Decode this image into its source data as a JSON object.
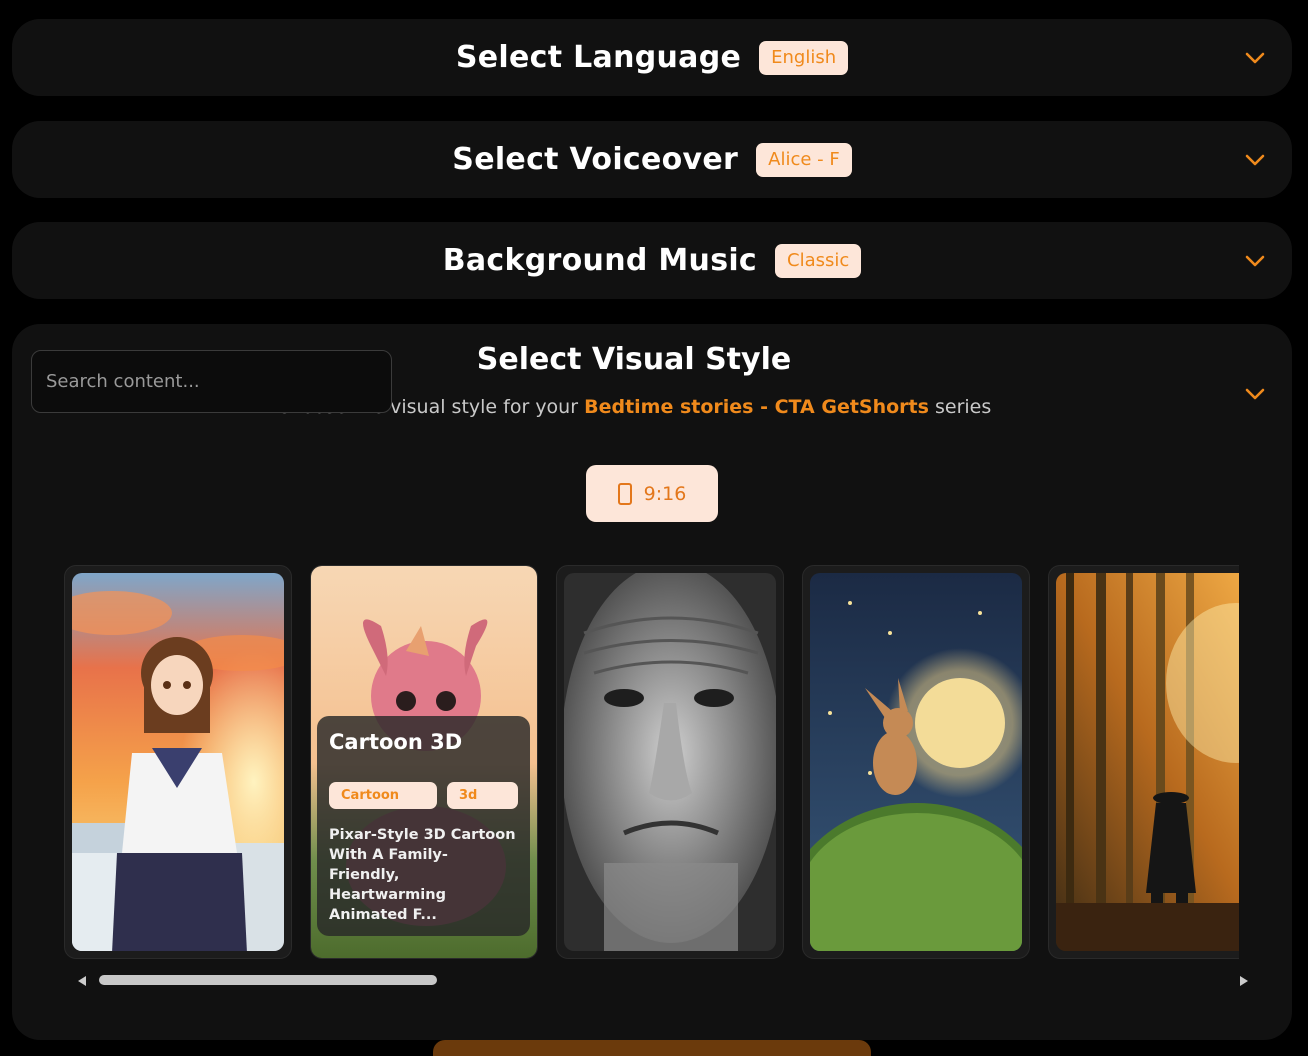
{
  "language": {
    "title": "Select Language",
    "value": "English"
  },
  "voiceover": {
    "title": "Select Voiceover",
    "value": "Alice - F"
  },
  "music": {
    "title": "Background Music",
    "value": "Classic"
  },
  "visual": {
    "title": "Select Visual Style",
    "subtitle_prefix": "Choose the visual style for your",
    "series_name": "Bedtime stories - CTA GetShorts",
    "subtitle_suffix": "series",
    "search_placeholder": "Search content...",
    "ratio": "9:16",
    "cards": [
      {
        "name": "anime-style",
        "image": "anime girl at sunset"
      },
      {
        "name": "cartoon-3d",
        "image": "pixar style baby dragon",
        "title": "Cartoon 3D",
        "tags": [
          "Cartoon",
          "3d"
        ],
        "description": "Pixar-Style 3D Cartoon With A Family-Friendly, Heartwarming Animated F..."
      },
      {
        "name": "pencil-sketch",
        "image": "pencil portrait of an old man"
      },
      {
        "name": "storybook",
        "image": "rabbit on hill under full moon"
      },
      {
        "name": "cinematic",
        "image": "samurai walking in bamboo forest"
      }
    ]
  },
  "colors": {
    "accent": "#f08a1c",
    "badge_bg": "#fde6d9",
    "panel": "#111111"
  }
}
